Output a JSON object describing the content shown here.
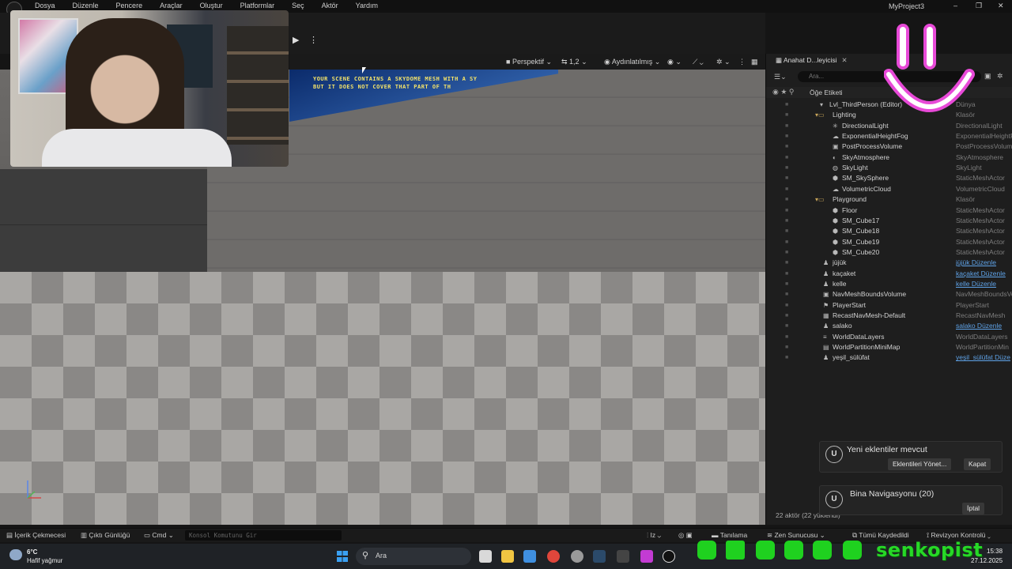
{
  "menubar": {
    "items": [
      "Dosya",
      "Düzenle",
      "Pencere",
      "Araçlar",
      "Oluştur",
      "Platformlar",
      "Seç",
      "Aktör",
      "Yardım"
    ],
    "project_title": "MyProject3",
    "minimize": "–",
    "maximize": "❐",
    "close": "✕"
  },
  "toolbar": {
    "play_icon": "▶",
    "more_icon": "⋮"
  },
  "viewport_toolbar": {
    "perspective": "Perspektif",
    "camera_speed": "1,2",
    "lit_mode": "Aydınlatılmış"
  },
  "viewport": {
    "sky_warning": "YOUR SCENE CONTAINS A SKYDOME MESH WITH A SY\nBUT IT DOES NOT COVER THAT PART OF TH"
  },
  "outliner": {
    "tab_label": "Anahat D...leyicisi",
    "search_placeholder": "Ara...",
    "column_label": "Öğe Etiketi",
    "rows": [
      {
        "label": "Lvl_ThirdPerson (Editor)",
        "type": "Dünya",
        "indent": 0,
        "icon": "level-icon"
      },
      {
        "label": "Lighting",
        "type": "Klasör",
        "indent": 1,
        "icon": "folder-icon"
      },
      {
        "label": "DirectionalLight",
        "type": "DirectionalLight",
        "indent": 2,
        "icon": "light-icon"
      },
      {
        "label": "ExponentialHeightFog",
        "type": "ExponentialHeightFog",
        "indent": 2,
        "icon": "fog-icon"
      },
      {
        "label": "PostProcessVolume",
        "type": "PostProcessVolume",
        "indent": 2,
        "icon": "volume-icon"
      },
      {
        "label": "SkyAtmosphere",
        "type": "SkyAtmosphere",
        "indent": 2,
        "icon": "sky-icon"
      },
      {
        "label": "SkyLight",
        "type": "SkyLight",
        "indent": 2,
        "icon": "skylight-icon"
      },
      {
        "label": "SM_SkySphere",
        "type": "StaticMeshActor",
        "indent": 2,
        "icon": "mesh-icon"
      },
      {
        "label": "VolumetricCloud",
        "type": "VolumetricCloud",
        "indent": 2,
        "icon": "cloud-icon"
      },
      {
        "label": "Playground",
        "type": "Klasör",
        "indent": 1,
        "icon": "folder-icon"
      },
      {
        "label": "Floor",
        "type": "StaticMeshActor",
        "indent": 2,
        "icon": "mesh-icon"
      },
      {
        "label": "SM_Cube17",
        "type": "StaticMeshActor",
        "indent": 2,
        "icon": "mesh-icon"
      },
      {
        "label": "SM_Cube18",
        "type": "StaticMeshActor",
        "indent": 2,
        "icon": "mesh-icon"
      },
      {
        "label": "SM_Cube19",
        "type": "StaticMeshActor",
        "indent": 2,
        "icon": "mesh-icon"
      },
      {
        "label": "SM_Cube20",
        "type": "StaticMeshActor",
        "indent": 2,
        "icon": "mesh-icon"
      },
      {
        "label": "jüjük",
        "type": "jüjük Düzenle",
        "indent": 1,
        "icon": "pawn-icon",
        "link": true
      },
      {
        "label": "kaçaket",
        "type": "kaçaket Düzenle",
        "indent": 1,
        "icon": "pawn-icon",
        "link": true
      },
      {
        "label": "kelle",
        "type": "kelle Düzenle",
        "indent": 1,
        "icon": "pawn-icon",
        "link": true
      },
      {
        "label": "NavMeshBoundsVolume",
        "type": "NavMeshBoundsVolume",
        "indent": 1,
        "icon": "volume-icon"
      },
      {
        "label": "PlayerStart",
        "type": "PlayerStart",
        "indent": 1,
        "icon": "player-icon"
      },
      {
        "label": "RecastNavMesh-Default",
        "type": "RecastNavMesh",
        "indent": 1,
        "icon": "navmesh-icon"
      },
      {
        "label": "salako",
        "type": "salako Düzenle",
        "indent": 1,
        "icon": "pawn-icon",
        "link": true
      },
      {
        "label": "WorldDataLayers",
        "type": "WorldDataLayers",
        "indent": 1,
        "icon": "layers-icon"
      },
      {
        "label": "WorldPartitionMiniMap",
        "type": "WorldPartitionMin",
        "indent": 1,
        "icon": "minimap-icon"
      },
      {
        "label": "yeşil_sülüfat",
        "type": "yeşil_sülüfat Düze",
        "indent": 1,
        "icon": "pawn-icon",
        "link": true
      }
    ],
    "footer": "22 aktör (22 yüklendi)"
  },
  "notifications": {
    "plugins": {
      "title": "Yeni eklentiler mevcut",
      "manage_label": "Eklentileri Yönet...",
      "close_label": "Kapat"
    },
    "navigation": {
      "title": "Bina Navigasyonu (20)",
      "cancel_label": "İptal"
    }
  },
  "bottombar": {
    "content_drawer": "İçerik Çekmecesi",
    "output_log": "Çıktı Günlüğü",
    "cmd": "Cmd",
    "console_placeholder": "Konsol Komutunu Gir",
    "derived_data": "Tanılama",
    "zen_server": "Zen Sunucusu",
    "all_saved": "Tümü Kaydedildi",
    "revision_control": "Revizyon Kontrolü"
  },
  "taskbar": {
    "temperature": "6°C",
    "weather": "Hafif yağmur",
    "search_label": "Ara",
    "time": "15:38",
    "date": "27.12.2025"
  },
  "social": {
    "handle": "senkopist"
  },
  "colors": {
    "accent_green": "#27d827",
    "smiley_pink": "#e84ad8",
    "link_blue": "#5fa3e8"
  }
}
